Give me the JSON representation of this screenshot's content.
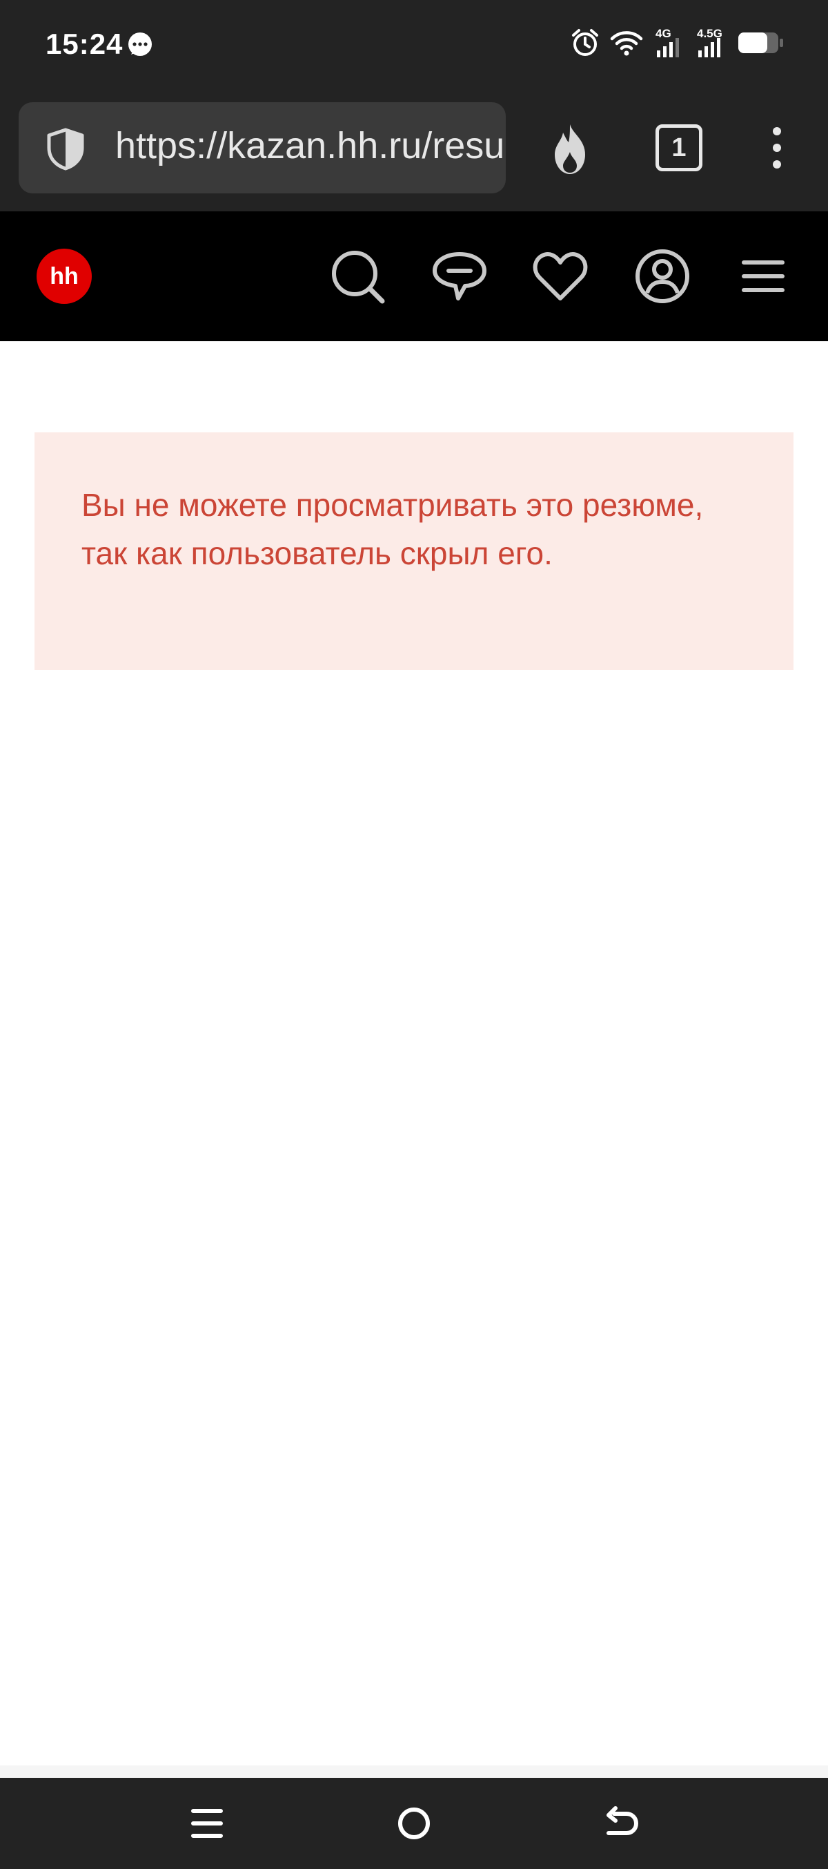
{
  "status_bar": {
    "time": "15:24",
    "signal_1_label": "4G",
    "signal_2_label": "4.5G",
    "icons": [
      "message-icon",
      "alarm-icon",
      "wifi-icon",
      "signal-icon",
      "signal-icon",
      "battery-icon"
    ]
  },
  "browser": {
    "url": "https://kazan.hh.ru/resume",
    "tab_count": "1",
    "icons": [
      "shield-icon",
      "fire-icon",
      "tabs-icon",
      "more-vertical-icon"
    ]
  },
  "site_header": {
    "logo_text": "hh",
    "logo_color": "#e00000",
    "nav_icons": [
      "search-icon",
      "chat-icon",
      "heart-icon",
      "profile-icon",
      "hamburger-icon"
    ]
  },
  "error": {
    "message": "Вы не можете просматривать это резюме, так как пользователь скрыл его.",
    "text_color": "#cb4536",
    "background_color": "#fcebe7"
  },
  "system_nav": {
    "icons": [
      "recents-icon",
      "home-icon",
      "back-icon"
    ]
  }
}
